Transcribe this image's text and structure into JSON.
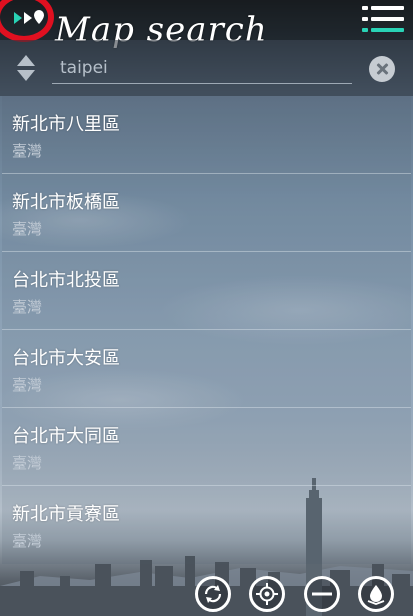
{
  "app": {
    "title": "Map search"
  },
  "search": {
    "placeholder": "taipei"
  },
  "results": [
    {
      "name": "新北市八里區",
      "region": "臺灣"
    },
    {
      "name": "新北市板橋區",
      "region": "臺灣"
    },
    {
      "name": "台北市北投區",
      "region": "臺灣"
    },
    {
      "name": "台北市大安區",
      "region": "臺灣"
    },
    {
      "name": "台北市大同區",
      "region": "臺灣"
    },
    {
      "name": "新北市貢寮區",
      "region": "臺灣"
    }
  ],
  "icons": {
    "logo": "play-forward-pin-icon",
    "menu": "list-menu-icon",
    "sort": "sort-updown-icon",
    "clear": "clear-x-icon",
    "controls": [
      "rotate-icon",
      "locate-crosshair-icon",
      "zoom-out-minus-icon",
      "layers-drop-icon"
    ]
  },
  "colors": {
    "accent": "#29d3b6",
    "highlight_ring": "#e01020",
    "text_primary": "#ffffff",
    "text_secondary": "#c3ccd6"
  }
}
